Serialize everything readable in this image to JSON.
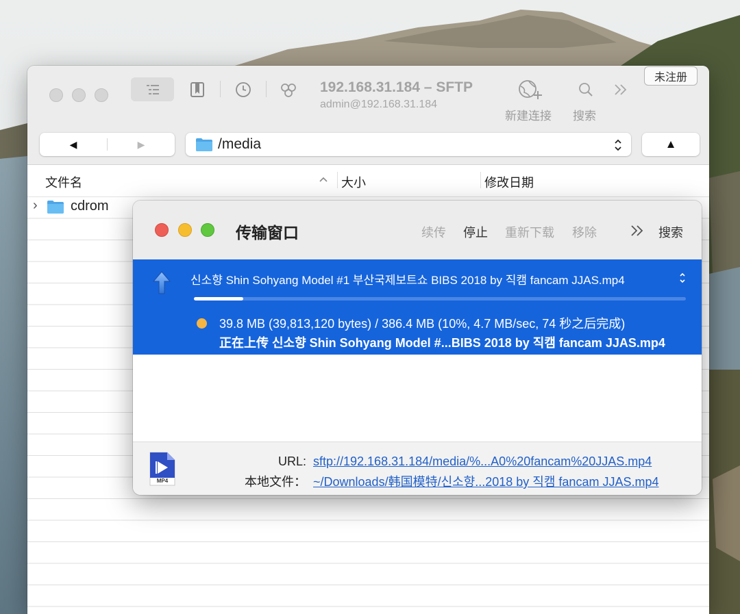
{
  "main_window": {
    "title": "192.168.31.184 – SFTP",
    "subtitle": "admin@192.168.31.184",
    "register_button": "未注册",
    "toolbar": {
      "new_connection_label": "新建连接",
      "search_label": "搜索"
    },
    "nav": {
      "back_glyph": "◀",
      "forward_glyph": "▶",
      "up_glyph": "▲"
    },
    "path": "/media",
    "columns": {
      "name": "文件名",
      "size": "大小",
      "modified": "修改日期"
    },
    "files": [
      {
        "name": "cdrom",
        "type": "folder",
        "disclosure": "›"
      }
    ]
  },
  "transfer_window": {
    "title": "传输窗口",
    "actions": {
      "resume": "续传",
      "stop": "停止",
      "redownload": "重新下载",
      "remove": "移除",
      "more_glyph": "»",
      "search": "搜索"
    },
    "item": {
      "direction_icon": "upload-arrow-icon",
      "file_name": "신소향 Shin Sohyang Model #1 부산국제보트쇼 BIBS 2018 by 직캠 fancam JJAS.mp4",
      "progress_fraction": 0.1,
      "status_dot_color": "#f5b542",
      "status_line": "39.8 MB (39,813,120 bytes) / 386.4 MB (10%, 4.7 MB/sec, 74 秒之后完成)",
      "action_line": "正在上传 신소향 Shin Sohyang Model #...BIBS 2018 by 직캠 fancam JJAS.mp4"
    },
    "footer": {
      "file_type_badge": "MP4",
      "url_label": "URL:",
      "url_value": "sftp://192.168.31.184/media/%...A0%20fancam%20JJAS.mp4",
      "local_label": "本地文件：",
      "local_value": "~/Downloads/韩国模特/신소향...2018 by 직캠 fancam JJAS.mp4"
    }
  },
  "colors": {
    "selection_blue": "#1664dc",
    "close_red": "#ee5f57",
    "minimize_yellow": "#f6be2f",
    "zoom_green": "#5fc83f",
    "link_blue": "#2160c8",
    "folder_blue": "#5ab2ee"
  }
}
